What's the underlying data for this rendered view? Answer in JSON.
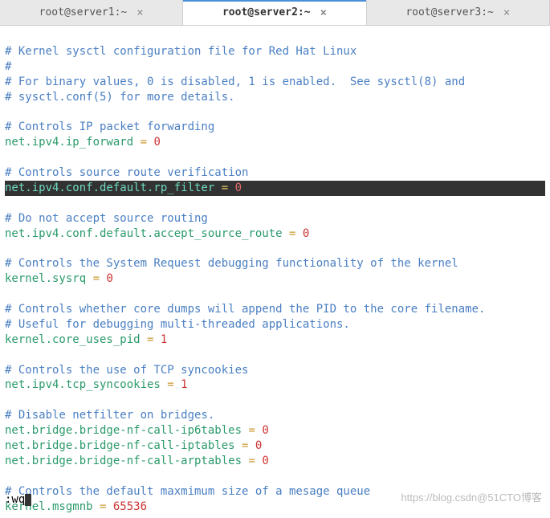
{
  "tabs": [
    {
      "label": "root@server1:~",
      "active": false
    },
    {
      "label": "root@server2:~",
      "active": true
    },
    {
      "label": "root@server3:~",
      "active": false
    }
  ],
  "lines": {
    "c1": "# Kernel sysctl configuration file for Red Hat Linux",
    "c2": "#",
    "c3": "# For binary values, 0 is disabled, 1 is enabled.  See sysctl(8) and",
    "c4": "# sysctl.conf(5) for more details.",
    "c5": "# Controls IP packet forwarding",
    "k5": "net.ipv4.ip_forward",
    "v5": "0",
    "c6": "# Controls source route verification",
    "k6": "net.ipv4.conf.default.rp_filter",
    "v6": "0",
    "c7": "# Do not accept source routing",
    "k7": "net.ipv4.conf.default.accept_source_route",
    "v7": "0",
    "c8": "# Controls the System Request debugging functionality of the kernel",
    "k8": "kernel.sysrq",
    "v8": "0",
    "c9a": "# Controls whether core dumps will append the PID to the core filename.",
    "c9b": "# Useful for debugging multi-threaded applications.",
    "k9": "kernel.core_uses_pid",
    "v9": "1",
    "c10": "# Controls the use of TCP syncookies",
    "k10": "net.ipv4.tcp_syncookies",
    "v10": "1",
    "c11": "# Disable netfilter on bridges.",
    "k11a": "net.bridge.bridge-nf-call-ip6tables",
    "v11a": "0",
    "k11b": "net.bridge.bridge-nf-call-iptables",
    "v11b": "0",
    "k11c": "net.bridge.bridge-nf-call-arptables",
    "v11c": "0",
    "c12": "# Controls the default maxmimum size of a mesage queue",
    "k12": "kernel.msgmnb",
    "v12": "65536",
    "eq": " = "
  },
  "status": ":wq",
  "watermark": "https://blog.csdn@51CTO博客"
}
